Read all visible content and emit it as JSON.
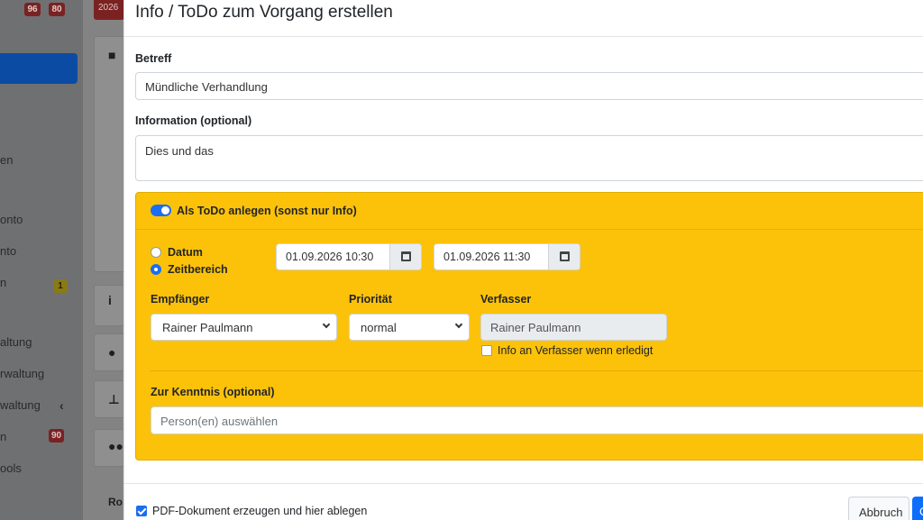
{
  "background": {
    "badges": [
      "96",
      "80"
    ],
    "date_chip": "2026",
    "nav_items": [
      "en",
      "onto",
      "nto",
      "n",
      "altung",
      "rwaltung",
      "waltung",
      "n",
      "ools"
    ],
    "nav_badges": [
      "1",
      "90"
    ],
    "row_fragment": "Ro"
  },
  "modal": {
    "title": "Info / ToDo zum Vorgang erstellen",
    "subject_label": "Betreff",
    "subject_value": "Mündliche Verhandlung",
    "info_label": "Information (optional)",
    "info_value": "Dies und das",
    "todo": {
      "toggle_label": "Als ToDo anlegen (sonst nur Info)",
      "toggle_on": true,
      "radio_date": "Datum",
      "radio_range": "Zeitbereich",
      "selected_mode": "Zeitbereich",
      "start": "01.09.2026 10:30",
      "end": "01.09.2026 11:30",
      "recipient_label": "Empfänger",
      "recipient_value": "Rainer Paulmann",
      "priority_label": "Priorität",
      "priority_value": "normal",
      "author_label": "Verfasser",
      "author_value": "Rainer Paulmann",
      "notify_label": "Info an Verfasser wenn erledigt",
      "notify_checked": false,
      "cc_label": "Zur Kenntnis (optional)",
      "cc_placeholder": "Person(en) auswählen"
    },
    "footer": {
      "pdf_label": "PDF-Dokument erzeugen und hier ablegen",
      "pdf_checked": true,
      "cancel_label": "Abbruch",
      "confirm_label": "O"
    }
  },
  "colors": {
    "accent": "#0d6efd",
    "todo_panel": "#fcc20a",
    "badge": "#7a2222"
  }
}
